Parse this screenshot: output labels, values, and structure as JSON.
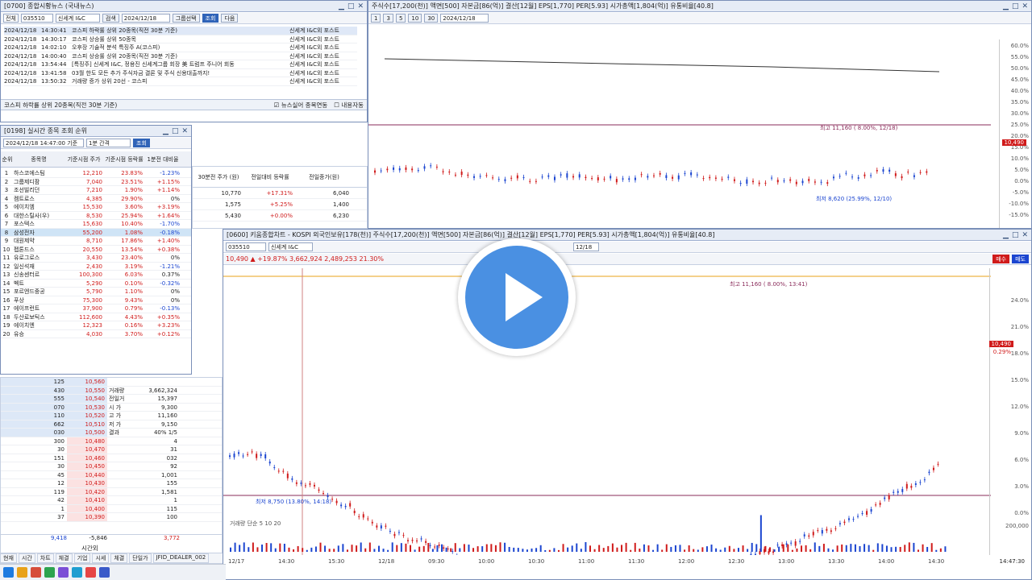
{
  "news_window": {
    "title": "[0700] 종합시황뉴스 (국내뉴스)",
    "toolbar": {
      "all_label": "전체",
      "code": "035510",
      "company": "신세계 I&C",
      "filter_btn": "검색",
      "date": "2024/12/18",
      "group_btn": "그룹선택",
      "view_btn": "조회",
      "next_btn": "다음"
    },
    "rows": [
      {
        "date": "2024/12/18",
        "time": "14:30:41",
        "title": "코스피 하락률 상위 20종목(직전 30분 기준)",
        "source": "신세계 I&C외 포스트"
      },
      {
        "date": "2024/12/18",
        "time": "14:30:17",
        "title": "코스피 상승률 상위 50종목",
        "source": "신세계 I&C외 포스트"
      },
      {
        "date": "2024/12/18",
        "time": "14:02:10",
        "title": "오후장 기술적 분석 특징주 A(코스피)",
        "source": "신세계 I&C외 포스트"
      },
      {
        "date": "2024/12/18",
        "time": "14:00:40",
        "title": "코스피 상승률 상위 20종목(직전 30분 기준)",
        "source": "신세계 I&C외 포스트"
      },
      {
        "date": "2024/12/18",
        "time": "13:54:44",
        "title": "[특징주] 신세계 I&C, 정용진 신세계그룹 회장 美 트럼프 주니어 회동",
        "source": "신세계 I&C외 포스트"
      },
      {
        "date": "2024/12/18",
        "time": "13:41:58",
        "title": "03월 한도 모든 추가 주식자금 결론 및 주식 신용대출까지!",
        "source": "신세계 I&C외 포스트"
      },
      {
        "date": "2024/12/18",
        "time": "13:50:32",
        "title": "거래량 증가 상위 20선 - 코스피",
        "source": "신세계 I&C외 포스트"
      }
    ],
    "selected_title": "코스피 하락률 상위 20종목(직전 30분 기준)",
    "checkbox1": "뉴스실어 종목연동",
    "checkbox2": "내용자동"
  },
  "rank_window": {
    "title": "[0198] 실시간 종목 조회 순위",
    "date": "2024/12/18 14:47:00 기준",
    "interval": "1분 간격",
    "query_btn": "조회",
    "headers": [
      "순위",
      "종목명",
      "기준시점 주가",
      "기준시점 등락률",
      "1분전 대비율"
    ],
    "rows": [
      {
        "rank": "1",
        "name": "하스코에스팀",
        "price": "12,210",
        "rate": "23.83%",
        "chg": "-1.23%",
        "arrow": "▲"
      },
      {
        "rank": "2",
        "name": "그룹제디팜",
        "price": "7,040",
        "rate": "23.51%",
        "chg": "+1.15%",
        "arrow": "▲"
      },
      {
        "rank": "3",
        "name": "조선빌리던",
        "price": "7,210",
        "rate": "1.90%",
        "chg": "+1.14%",
        "arrow": "▲"
      },
      {
        "rank": "4",
        "name": "켐트로스",
        "price": "4,385",
        "rate": "29.90%",
        "chg": "0%",
        "arrow": "▲"
      },
      {
        "rank": "5",
        "name": "에이치엠",
        "price": "15,530",
        "rate": "3.60%",
        "chg": "+3.19%",
        "arrow": "▲"
      },
      {
        "rank": "6",
        "name": "대한스틸사(우)",
        "price": "8,530",
        "rate": "25.94%",
        "chg": "+1.64%",
        "arrow": "▲"
      },
      {
        "rank": "7",
        "name": "포스텍스",
        "price": "15,630",
        "rate": "10.40%",
        "chg": "-1.70%",
        "arrow": "▲"
      },
      {
        "rank": "8",
        "name": "삼성전자",
        "price": "55,200",
        "rate": "1.08%",
        "chg": "-0.18%",
        "arrow": "▲"
      },
      {
        "rank": "9",
        "name": "대원제약",
        "price": "8,710",
        "rate": "17.86%",
        "chg": "+1.40%",
        "arrow": "▲"
      },
      {
        "rank": "10",
        "name": "펩톤드스",
        "price": "20,550",
        "rate": "13.54%",
        "chg": "+0.38%",
        "arrow": "▲"
      },
      {
        "rank": "11",
        "name": "유로그로스",
        "price": "3,430",
        "rate": "23.40%",
        "chg": "0%",
        "arrow": "▲"
      },
      {
        "rank": "12",
        "name": "일신석재",
        "price": "2,430",
        "rate": "3.19%",
        "chg": "-1.21%",
        "arrow": "▲"
      },
      {
        "rank": "13",
        "name": "신송센터르",
        "price": "100,300",
        "rate": "6.03%",
        "chg": "0.37%",
        "arrow": "▲"
      },
      {
        "rank": "14",
        "name": "벡트",
        "price": "5,290",
        "rate": "0.10%",
        "chg": "-0.32%",
        "arrow": "▲"
      },
      {
        "rank": "15",
        "name": "포르엔드중공",
        "price": "5,790",
        "rate": "1.10%",
        "chg": "0%",
        "arrow": "▲"
      },
      {
        "rank": "16",
        "name": "푸상",
        "price": "75,300",
        "rate": "9.43%",
        "chg": "0%",
        "arrow": "▲"
      },
      {
        "rank": "17",
        "name": "에이프런트",
        "price": "37,900",
        "rate": "0.79%",
        "chg": "-0.13%",
        "arrow": "▲"
      },
      {
        "rank": "18",
        "name": "두산로보틱스",
        "price": "112,600",
        "rate": "4.43%",
        "chg": "+0.35%",
        "arrow": "▲"
      },
      {
        "rank": "19",
        "name": "에이치엔",
        "price": "12,323",
        "rate": "0.16%",
        "chg": "+3.23%",
        "arrow": "▲"
      },
      {
        "rank": "20",
        "name": "유승",
        "price": "4,030",
        "rate": "3.70%",
        "chg": "+0.12%",
        "arrow": "▲"
      }
    ],
    "side_headers": [
      "30분전 주가 (원)",
      "전일대비 등락률",
      "전일종가(원)"
    ],
    "side_rows": [
      {
        "a": "10,770",
        "b": "+17.31%",
        "c": "6,040"
      },
      {
        "a": "1,575",
        "b": "+5.25%",
        "c": "1,400"
      },
      {
        "a": "5,430",
        "b": "+0.00%",
        "c": "6,230"
      }
    ]
  },
  "orderbook": {
    "rows": [
      {
        "q": "125",
        "p": "10,560",
        "k": "",
        "v": ""
      },
      {
        "q": "430",
        "p": "10,550",
        "k": "거래량",
        "v": "3,662,324"
      },
      {
        "q": "555",
        "p": "10,540",
        "k": "전일거",
        "v": "15,397"
      },
      {
        "q": "070",
        "p": "10,530",
        "k": "시 가",
        "v": "9,300"
      },
      {
        "q": "110",
        "p": "10,520",
        "k": "고 가",
        "v": "11,160"
      },
      {
        "q": "662",
        "p": "10,510",
        "k": "저 가",
        "v": "9,150"
      },
      {
        "q": "030",
        "p": "10,500",
        "k": "결과",
        "v": "40% 1/5"
      },
      {
        "q": "300",
        "p": "10,480",
        "k": "",
        "v": "4"
      },
      {
        "q": "30",
        "p": "10,470",
        "k": "",
        "v": "31"
      },
      {
        "q": "151",
        "p": "10,460",
        "k": "",
        "v": "032"
      },
      {
        "q": "30",
        "p": "10,450",
        "k": "",
        "v": "92"
      },
      {
        "q": "45",
        "p": "10,440",
        "k": "",
        "v": "1,001"
      },
      {
        "q": "12",
        "p": "10,430",
        "k": "",
        "v": "155"
      },
      {
        "q": "119",
        "p": "10,420",
        "k": "",
        "v": "1,581"
      },
      {
        "q": "42",
        "p": "10,410",
        "k": "",
        "v": "1"
      },
      {
        "q": "1",
        "p": "10,400",
        "k": "",
        "v": "115"
      },
      {
        "q": "37",
        "p": "10,390",
        "k": "",
        "v": "100"
      }
    ],
    "total_left": "9,418",
    "total_mid": "-5,846",
    "total_right": "3,772",
    "footer": "시간외"
  },
  "top_chart": {
    "info": "주식수[17,200(천)] 액면[500] 자본금[86(억)] 결산[12월] EPS[1,770] PER[5.93] 시가총액[1,804(억)] 유통비율[40.8]",
    "high_label": "최고 11,160 ( 8.00%, 12/18)",
    "low_label": "최저 8,620 (25.99%, 12/10)",
    "price_box": "10,490",
    "date": "2024/12/18",
    "axis": [
      "60.0%",
      "55.0%",
      "50.0%",
      "45.0%",
      "40.0%",
      "35.0%",
      "30.0%",
      "25.0%",
      "20.0%",
      "15.0%",
      "10.0%",
      "5.0%",
      "0.0%",
      "-5.0%",
      "-10.0%",
      "-15.0%"
    ]
  },
  "bottom_chart": {
    "title": "[0600] 키움종합차트 - KOSPI 외국인보유[178(천)] 주식수[17,200(천)] 액면[500] 자본금[86(억)] 결산[12월] EPS[1,770] PER[5.93] 시가총액[1,804(억)] 유통비율[40.8]",
    "code": "035510",
    "name": "신세계 I&C",
    "date": "12/18",
    "price_row": "10,490 ▲ +19.87%  3,662,924  2,489,253  21.30%",
    "high_label": "최고 11,160 ( 8.00%, 13:41)",
    "low_label": "최저 8,750 (13.80%, 14:18)",
    "price_box": "10,490",
    "price_box2": "0.29%",
    "buy_btn": "매수",
    "sell_btn": "매도",
    "volume_label": "거래량 단순 5 10 20",
    "axis": [
      "24.0%",
      "21.0%",
      "18.0%",
      "15.0%",
      "12.0%",
      "9.0%",
      "6.0%",
      "3.0%",
      "0.0%"
    ],
    "vol_axis": [
      "200,000"
    ],
    "x_labels": [
      "12/17",
      "14:30",
      "15:30",
      "12/18",
      "09:30",
      "10:00",
      "10:30",
      "11:00",
      "11:30",
      "12:00",
      "12:30",
      "13:00",
      "13:30",
      "14:00",
      "14:30"
    ],
    "clock": "14:47:30"
  },
  "taskbar": {
    "tabs": [
      "현재",
      "시간",
      "차트",
      "체결",
      "기업",
      "시세",
      "체결",
      "단일가",
      "JFID_DEALER_002"
    ]
  }
}
